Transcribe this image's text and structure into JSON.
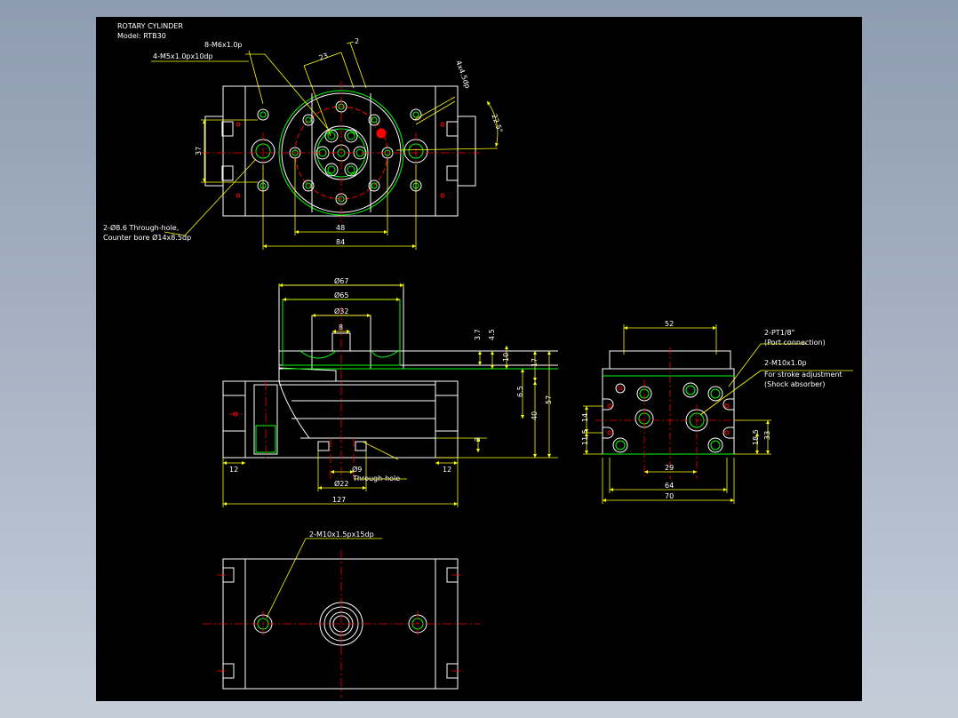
{
  "title_block": {
    "line1": "ROTARY CYLINDER",
    "line2": "Model: RTB30"
  },
  "top_view": {
    "notes": {
      "holes_8": "8-M6x1.0p",
      "holes_4": "4-M5x1.0px10dp",
      "thru_line1": "2-Ø8.6 Through-hole,",
      "thru_line2": "Counter bore Ø14x8.5dp",
      "chamfer": "4x4.5dp"
    },
    "dims": {
      "d23": "23",
      "d2": "2",
      "d22_5": "22.5°",
      "d37": "37",
      "d48": "48",
      "d84": "84"
    }
  },
  "front_view": {
    "dims": {
      "d67": "Ø67",
      "d65": "Ø65",
      "d32": "Ø32",
      "d8": "8",
      "d3_7": "3.7",
      "d4_5": "4.5",
      "d10": "10",
      "d17": "17",
      "d6_5": "6.5",
      "d40": "40",
      "d57": "57",
      "d3": "3",
      "d12_left": "12",
      "d12_right": "12",
      "d9": "Ø9",
      "d22": "Ø22",
      "d127": "127"
    },
    "notes": {
      "through": "Through-hole"
    }
  },
  "side_view": {
    "dims": {
      "d52": "52",
      "d14": "14",
      "d11_5": "11.5",
      "d18_5": "18.5",
      "d33": "33",
      "d29": "29",
      "d64": "64",
      "d70": "70"
    },
    "notes": {
      "port_line1": "2-PT1/8\"",
      "port_line2": "(Port connection)",
      "stroke_line1": "2-M10x1.0p",
      "stroke_line2": "For stroke adjustment",
      "stroke_line3": "(Shock absorber)"
    }
  },
  "bottom_view": {
    "notes": {
      "holes": "2-M10x1.5px15dp"
    }
  },
  "colors": {
    "background": "#000000",
    "outline": "#ffffff",
    "green": "#00ff00",
    "dimension": "#ffff00",
    "red": "#ff0000",
    "annotation": "#ffff66"
  }
}
